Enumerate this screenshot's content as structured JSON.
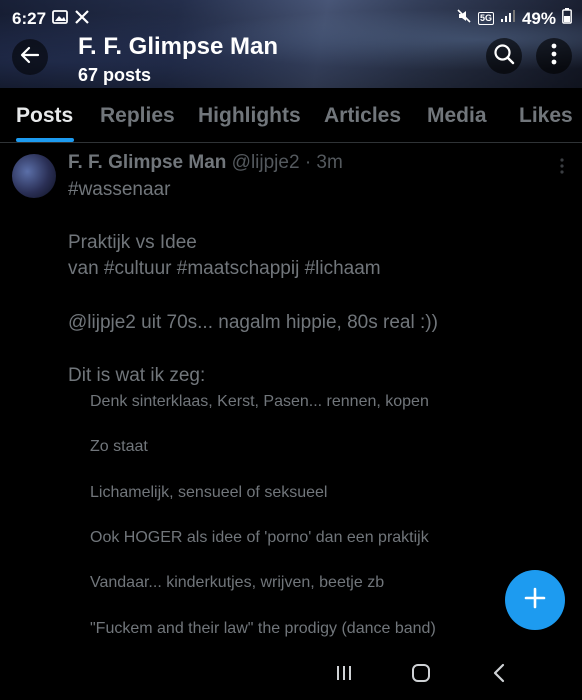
{
  "status_bar": {
    "time": "6:27",
    "battery": "49%",
    "network_badge": "5G",
    "icons": [
      "gallery-icon",
      "x-logo-icon",
      "mute-icon",
      "5g-icon",
      "signal-icon",
      "battery-icon"
    ]
  },
  "header": {
    "title": "F. F. Glimpse Man",
    "subtitle": "67 posts",
    "icons": [
      "back-arrow-icon",
      "search-icon",
      "more-vert-icon"
    ]
  },
  "tabs": [
    {
      "label": "Posts",
      "active": true
    },
    {
      "label": "Replies",
      "active": false
    },
    {
      "label": "Highlights",
      "active": false
    },
    {
      "label": "Articles",
      "active": false
    },
    {
      "label": "Media",
      "active": false
    },
    {
      "label": "Likes",
      "active": false
    }
  ],
  "post": {
    "author": "F. F. Glimpse Man",
    "handle": "@lijpje2",
    "time": "· 3m",
    "lines": [
      "#wassenaar",
      "Praktijk vs Idee",
      "van #cultuur #maatschappij #lichaam",
      "@lijpje2 uit 70s... nagalm hippie,  80s real :))",
      "Dit is wat ik zeg:"
    ],
    "list": [
      "Denk sinterklaas, Kerst, Pasen... rennen, kopen",
      "Zo staat",
      "Lichamelijk, sensueel of seksueel",
      "Ook HOGER als idee of 'porno' dan een praktijk",
      "Vandaar... kinderkutjes, wrijven, beetje zb",
      "\"Fuckem and their law\" the prodigy (dance band)"
    ]
  },
  "fab": {
    "icon": "plus-icon"
  },
  "nav": {
    "icons": [
      "recents-icon",
      "home-icon",
      "back-icon"
    ]
  },
  "colors": {
    "accent": "#1d9bf0",
    "background": "#000000",
    "muted_text": "#71767b"
  }
}
